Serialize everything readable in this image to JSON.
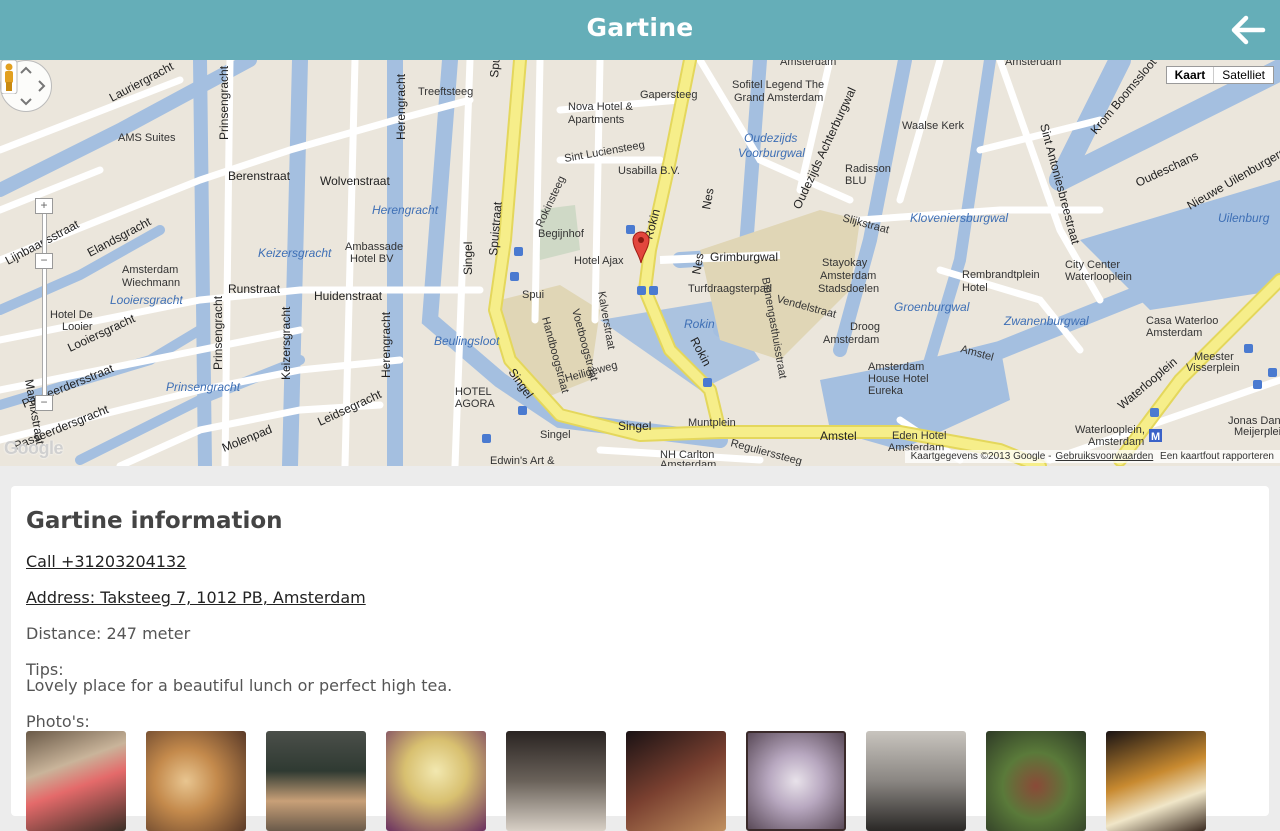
{
  "header": {
    "title": "Gartine",
    "back_icon": "arrow-left-icon"
  },
  "map": {
    "type_buttons": [
      "Kaart",
      "Satelliet"
    ],
    "attribution": "Kaartgegevens ©2013 Google -",
    "terms": "Gebruiksvoorwaarden",
    "report": "Een kaartfout rapporteren",
    "logo": "Google",
    "streets": [
      "Lauriergracht",
      "AMS Suites",
      "Prinsengracht",
      "Herengracht",
      "Spuistraat",
      "Berenstraat",
      "Wolvenstraat",
      "Elandsgracht",
      "Lijnbaansstraat",
      "Amsterdam Wiechmann",
      "Runstraat",
      "Huidenstraat",
      "Hotel De Looier",
      "Looiersgracht",
      "Passeerdersstraat",
      "Leidsegracht",
      "Molenpad",
      "Marnixstraat",
      "Keizersgracht",
      "Singel",
      "Ambassade Hotel BV",
      "Beulingsloot",
      "Hotel Ajax",
      "Spui",
      "Begijnhof",
      "Treeftsteeg",
      "Nova Hotel & Apartments",
      "Sint Luciensteeg",
      "Usabilla B.V.",
      "Gapersteeg",
      "Rokin",
      "Nes",
      "Grimburgwal",
      "Turfdraagsterpad",
      "Sofitel Legend The Grand Amsterdam",
      "Oudezijds Voorburgwal",
      "Oudezijds Achterburgwal",
      "Radisson BLU",
      "Waalse Kerk",
      "Stayokay Amsterdam Stadsdoelen",
      "Kloveniersburgwal",
      "Rembrandtplein Hotel",
      "Groenburgwal",
      "Droog Amsterdam",
      "Amsterdam House Hotel Eureka",
      "Muntplein",
      "Amstel",
      "Eden Hotel Amsterdam",
      "City Center Waterlooplein",
      "Zwanenburgwal",
      "Casa Waterloo Amsterdam",
      "Waterlooplein",
      "Waterlooplein, Amsterdam",
      "Meester Visserplein",
      "Jonas Daniel Meijerplein",
      "Sint Antoniesbreestraat",
      "Oudeschans",
      "Nieuwe Uilenburgerstraat",
      "Uilenburg",
      "Krom Boomssloot",
      "NH Carlton Amsterdam",
      "Edwin's Art &",
      "HOTEL AGORA",
      "Kalverstraat",
      "Heiligeweg",
      "Voetboogstraat",
      "Handboogstraat",
      "Rokinsteeg",
      "Binnengasthuisstraat",
      "Vendelstraat",
      "Slijkstraat",
      "Regulierssteeg",
      "Amsterdam",
      "Ambassade Hotel BV"
    ]
  },
  "info": {
    "heading": "Gartine information",
    "call": "Call +31203204132",
    "address": "Address: Taksteeg 7, 1012 PB, Amsterdam",
    "distance": "Distance: 247 meter",
    "tips_label": "Tips:",
    "tips_text": "Lovely place for a beautiful lunch or perfect high tea.",
    "photos_label": "Photo's:",
    "photo_count": 10
  },
  "colors": {
    "header": "#65aeb8",
    "water": "#a4bfe0",
    "road_major": "#f4ec86",
    "land": "#ebe6dc",
    "marker": "#e2463d"
  }
}
